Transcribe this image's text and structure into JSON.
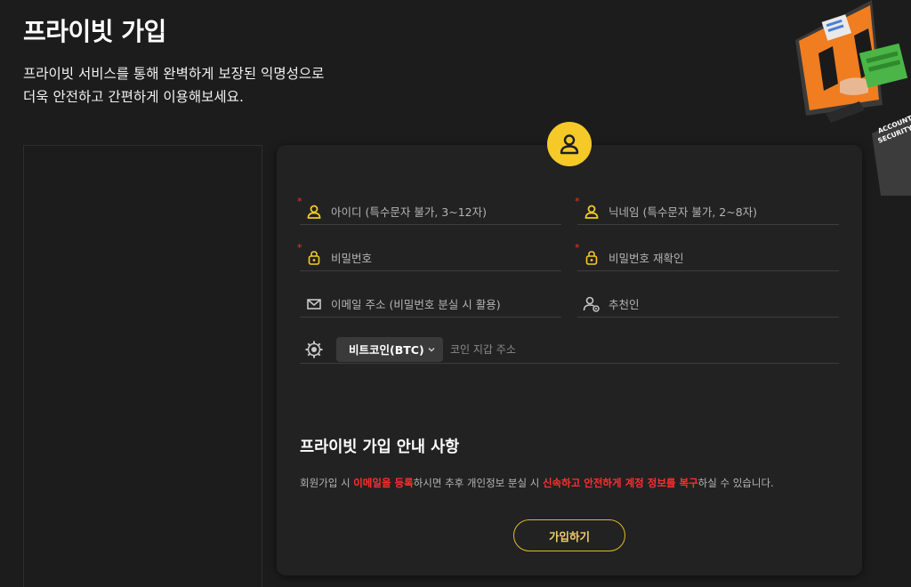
{
  "header": {
    "title": "프라이빗 가입",
    "desc_line1": "프라이빗 서비스를 통해 완벽하게 보장된 익명성으로",
    "desc_line2": "더욱 안전하고 간편하게 이용해보세요."
  },
  "hero": {
    "sign_line1": "ACCOUNT",
    "sign_line2": "SECURITY"
  },
  "form": {
    "id_placeholder": "아이디 (특수문자 불가, 3~12자)",
    "nickname_placeholder": "닉네임 (특수문자 불가, 2~8자)",
    "password_placeholder": "비밀번호",
    "password_confirm_placeholder": "비밀번호 재확인",
    "email_placeholder": "이메일 주소 (비밀번호 분실 시 활용)",
    "referrer_placeholder": "추천인",
    "coin_selected": "비트코인(BTC)",
    "wallet_placeholder": "코인 지갑 주소",
    "required_mark": "*"
  },
  "notice": {
    "title": "프라이빗 가입 안내 사항",
    "p1": "회원가입 시 ",
    "h1": "이메일을 등록",
    "p2": "하시면 추후 개인정보 분실 시 ",
    "h2": "신속하고 안전하게 계정 정보를 복구",
    "p3": "하실 수 있습니다."
  },
  "buttons": {
    "join": "가입하기"
  },
  "colors": {
    "accent": "#f5c928",
    "highlight": "#ff2e2e",
    "background": "#1c1c1c",
    "card": "#222222"
  }
}
